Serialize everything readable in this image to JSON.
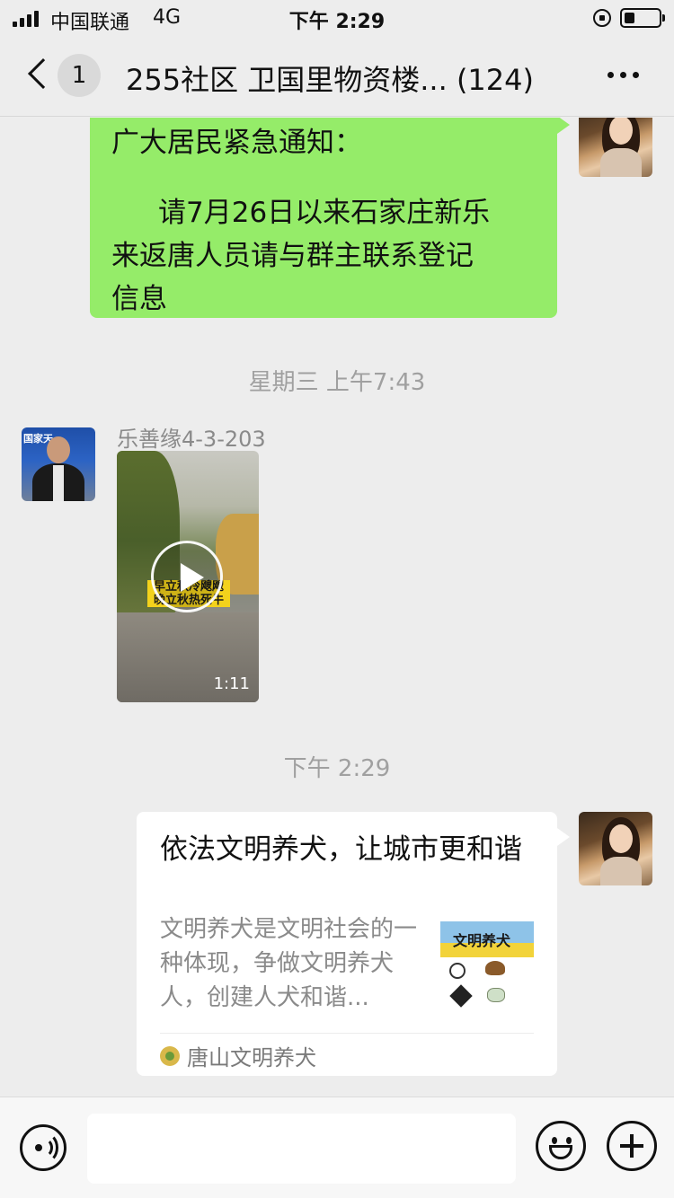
{
  "status_bar": {
    "carrier": "中国联通",
    "network": "4G",
    "time": "下午 2:29",
    "battery_level": 0.3
  },
  "nav": {
    "unread_count": "1",
    "title": "255社区 卫国里物资楼... (124)",
    "icons": [
      "back-icon",
      "more-icon"
    ]
  },
  "messages": {
    "notice": {
      "heading": "广大居民紧急通知：",
      "body_line1": "请7月26日以来石家庄新乐",
      "body_line2": "来返唐人员请与群主联系登记",
      "body_line3": "信息"
    },
    "timestamp_1": "星期三 上午7:43",
    "video_msg": {
      "sender": "乐善缘4-3-203",
      "duration": "1:11"
    },
    "timestamp_2": "下午 2:29",
    "link_card": {
      "title": "依法文明养犬，让城市更和谐",
      "desc": "文明养犬是文明社会的一种体现，争做文明养犬人，创建人犬和谐...",
      "source": "唐山文明养犬"
    }
  },
  "input_bar": {
    "placeholder": "",
    "icons": [
      "voice-icon",
      "emoji-icon",
      "plus-icon"
    ]
  },
  "colors": {
    "background": "#ededed",
    "own_bubble": "#95ec69",
    "card_bg": "#ffffff",
    "muted_text": "#a0a0a0"
  }
}
